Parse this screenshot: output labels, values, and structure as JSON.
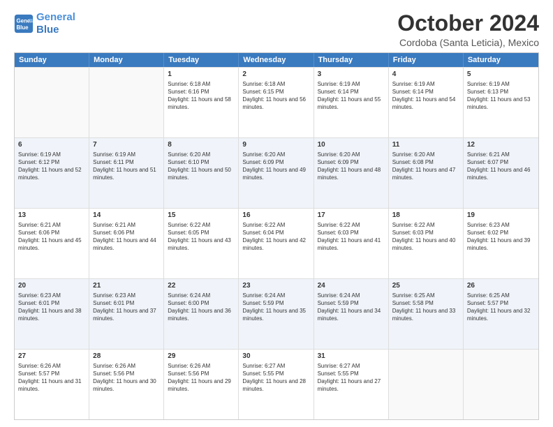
{
  "logo": {
    "line1": "General",
    "line2": "Blue"
  },
  "title": "October 2024",
  "subtitle": "Cordoba (Santa Leticia), Mexico",
  "header_days": [
    "Sunday",
    "Monday",
    "Tuesday",
    "Wednesday",
    "Thursday",
    "Friday",
    "Saturday"
  ],
  "weeks": [
    [
      {
        "day": "",
        "sunrise": "",
        "sunset": "",
        "daylight": "",
        "empty": true
      },
      {
        "day": "",
        "sunrise": "",
        "sunset": "",
        "daylight": "",
        "empty": true
      },
      {
        "day": "1",
        "sunrise": "Sunrise: 6:18 AM",
        "sunset": "Sunset: 6:16 PM",
        "daylight": "Daylight: 11 hours and 58 minutes.",
        "empty": false
      },
      {
        "day": "2",
        "sunrise": "Sunrise: 6:18 AM",
        "sunset": "Sunset: 6:15 PM",
        "daylight": "Daylight: 11 hours and 56 minutes.",
        "empty": false
      },
      {
        "day": "3",
        "sunrise": "Sunrise: 6:19 AM",
        "sunset": "Sunset: 6:14 PM",
        "daylight": "Daylight: 11 hours and 55 minutes.",
        "empty": false
      },
      {
        "day": "4",
        "sunrise": "Sunrise: 6:19 AM",
        "sunset": "Sunset: 6:14 PM",
        "daylight": "Daylight: 11 hours and 54 minutes.",
        "empty": false
      },
      {
        "day": "5",
        "sunrise": "Sunrise: 6:19 AM",
        "sunset": "Sunset: 6:13 PM",
        "daylight": "Daylight: 11 hours and 53 minutes.",
        "empty": false
      }
    ],
    [
      {
        "day": "6",
        "sunrise": "Sunrise: 6:19 AM",
        "sunset": "Sunset: 6:12 PM",
        "daylight": "Daylight: 11 hours and 52 minutes.",
        "empty": false
      },
      {
        "day": "7",
        "sunrise": "Sunrise: 6:19 AM",
        "sunset": "Sunset: 6:11 PM",
        "daylight": "Daylight: 11 hours and 51 minutes.",
        "empty": false
      },
      {
        "day": "8",
        "sunrise": "Sunrise: 6:20 AM",
        "sunset": "Sunset: 6:10 PM",
        "daylight": "Daylight: 11 hours and 50 minutes.",
        "empty": false
      },
      {
        "day": "9",
        "sunrise": "Sunrise: 6:20 AM",
        "sunset": "Sunset: 6:09 PM",
        "daylight": "Daylight: 11 hours and 49 minutes.",
        "empty": false
      },
      {
        "day": "10",
        "sunrise": "Sunrise: 6:20 AM",
        "sunset": "Sunset: 6:09 PM",
        "daylight": "Daylight: 11 hours and 48 minutes.",
        "empty": false
      },
      {
        "day": "11",
        "sunrise": "Sunrise: 6:20 AM",
        "sunset": "Sunset: 6:08 PM",
        "daylight": "Daylight: 11 hours and 47 minutes.",
        "empty": false
      },
      {
        "day": "12",
        "sunrise": "Sunrise: 6:21 AM",
        "sunset": "Sunset: 6:07 PM",
        "daylight": "Daylight: 11 hours and 46 minutes.",
        "empty": false
      }
    ],
    [
      {
        "day": "13",
        "sunrise": "Sunrise: 6:21 AM",
        "sunset": "Sunset: 6:06 PM",
        "daylight": "Daylight: 11 hours and 45 minutes.",
        "empty": false
      },
      {
        "day": "14",
        "sunrise": "Sunrise: 6:21 AM",
        "sunset": "Sunset: 6:06 PM",
        "daylight": "Daylight: 11 hours and 44 minutes.",
        "empty": false
      },
      {
        "day": "15",
        "sunrise": "Sunrise: 6:22 AM",
        "sunset": "Sunset: 6:05 PM",
        "daylight": "Daylight: 11 hours and 43 minutes.",
        "empty": false
      },
      {
        "day": "16",
        "sunrise": "Sunrise: 6:22 AM",
        "sunset": "Sunset: 6:04 PM",
        "daylight": "Daylight: 11 hours and 42 minutes.",
        "empty": false
      },
      {
        "day": "17",
        "sunrise": "Sunrise: 6:22 AM",
        "sunset": "Sunset: 6:03 PM",
        "daylight": "Daylight: 11 hours and 41 minutes.",
        "empty": false
      },
      {
        "day": "18",
        "sunrise": "Sunrise: 6:22 AM",
        "sunset": "Sunset: 6:03 PM",
        "daylight": "Daylight: 11 hours and 40 minutes.",
        "empty": false
      },
      {
        "day": "19",
        "sunrise": "Sunrise: 6:23 AM",
        "sunset": "Sunset: 6:02 PM",
        "daylight": "Daylight: 11 hours and 39 minutes.",
        "empty": false
      }
    ],
    [
      {
        "day": "20",
        "sunrise": "Sunrise: 6:23 AM",
        "sunset": "Sunset: 6:01 PM",
        "daylight": "Daylight: 11 hours and 38 minutes.",
        "empty": false
      },
      {
        "day": "21",
        "sunrise": "Sunrise: 6:23 AM",
        "sunset": "Sunset: 6:01 PM",
        "daylight": "Daylight: 11 hours and 37 minutes.",
        "empty": false
      },
      {
        "day": "22",
        "sunrise": "Sunrise: 6:24 AM",
        "sunset": "Sunset: 6:00 PM",
        "daylight": "Daylight: 11 hours and 36 minutes.",
        "empty": false
      },
      {
        "day": "23",
        "sunrise": "Sunrise: 6:24 AM",
        "sunset": "Sunset: 5:59 PM",
        "daylight": "Daylight: 11 hours and 35 minutes.",
        "empty": false
      },
      {
        "day": "24",
        "sunrise": "Sunrise: 6:24 AM",
        "sunset": "Sunset: 5:59 PM",
        "daylight": "Daylight: 11 hours and 34 minutes.",
        "empty": false
      },
      {
        "day": "25",
        "sunrise": "Sunrise: 6:25 AM",
        "sunset": "Sunset: 5:58 PM",
        "daylight": "Daylight: 11 hours and 33 minutes.",
        "empty": false
      },
      {
        "day": "26",
        "sunrise": "Sunrise: 6:25 AM",
        "sunset": "Sunset: 5:57 PM",
        "daylight": "Daylight: 11 hours and 32 minutes.",
        "empty": false
      }
    ],
    [
      {
        "day": "27",
        "sunrise": "Sunrise: 6:26 AM",
        "sunset": "Sunset: 5:57 PM",
        "daylight": "Daylight: 11 hours and 31 minutes.",
        "empty": false
      },
      {
        "day": "28",
        "sunrise": "Sunrise: 6:26 AM",
        "sunset": "Sunset: 5:56 PM",
        "daylight": "Daylight: 11 hours and 30 minutes.",
        "empty": false
      },
      {
        "day": "29",
        "sunrise": "Sunrise: 6:26 AM",
        "sunset": "Sunset: 5:56 PM",
        "daylight": "Daylight: 11 hours and 29 minutes.",
        "empty": false
      },
      {
        "day": "30",
        "sunrise": "Sunrise: 6:27 AM",
        "sunset": "Sunset: 5:55 PM",
        "daylight": "Daylight: 11 hours and 28 minutes.",
        "empty": false
      },
      {
        "day": "31",
        "sunrise": "Sunrise: 6:27 AM",
        "sunset": "Sunset: 5:55 PM",
        "daylight": "Daylight: 11 hours and 27 minutes.",
        "empty": false
      },
      {
        "day": "",
        "sunrise": "",
        "sunset": "",
        "daylight": "",
        "empty": true
      },
      {
        "day": "",
        "sunrise": "",
        "sunset": "",
        "daylight": "",
        "empty": true
      }
    ]
  ]
}
